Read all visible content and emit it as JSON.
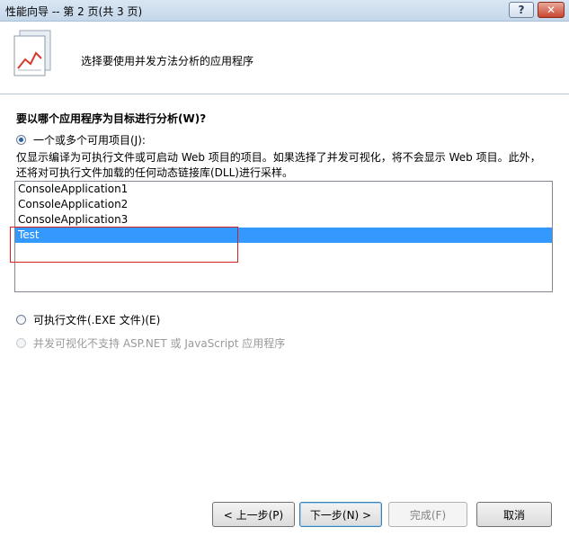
{
  "window": {
    "title": "性能向导 -- 第 2 页(共 3 页)",
    "help_label": "?",
    "close_label": "✕"
  },
  "header": {
    "title": "选择要使用并发方法分析的应用程序"
  },
  "body": {
    "question": "要以哪个应用程序为目标进行分析(W)?",
    "option_projects": {
      "label": "一个或多个可用项目(J):",
      "checked": true
    },
    "description_line1": "仅显示编译为可执行文件或可启动 Web 项目的项目。如果选择了并发可视化，将不会显示 Web 项目。此外，",
    "description_line2": "还将对可执行文件加载的任何动态链接库(DLL)进行采样。",
    "projects": [
      "ConsoleApplication1",
      "ConsoleApplication2",
      "ConsoleApplication3",
      "Test"
    ],
    "selected_project": "Test",
    "option_exe": {
      "label": "可执行文件(.EXE 文件)(E)",
      "checked": false
    },
    "option_aspnet": {
      "label": "并发可视化不支持 ASP.NET 或 JavaScript 应用程序",
      "disabled": true
    }
  },
  "footer": {
    "back_label": "< 上一步(P)",
    "next_label": "下一步(N) >",
    "finish_label": "完成(F)",
    "cancel_label": "取消"
  },
  "colors": {
    "selection": "#3399ff",
    "highlight_box": "#d42020"
  }
}
